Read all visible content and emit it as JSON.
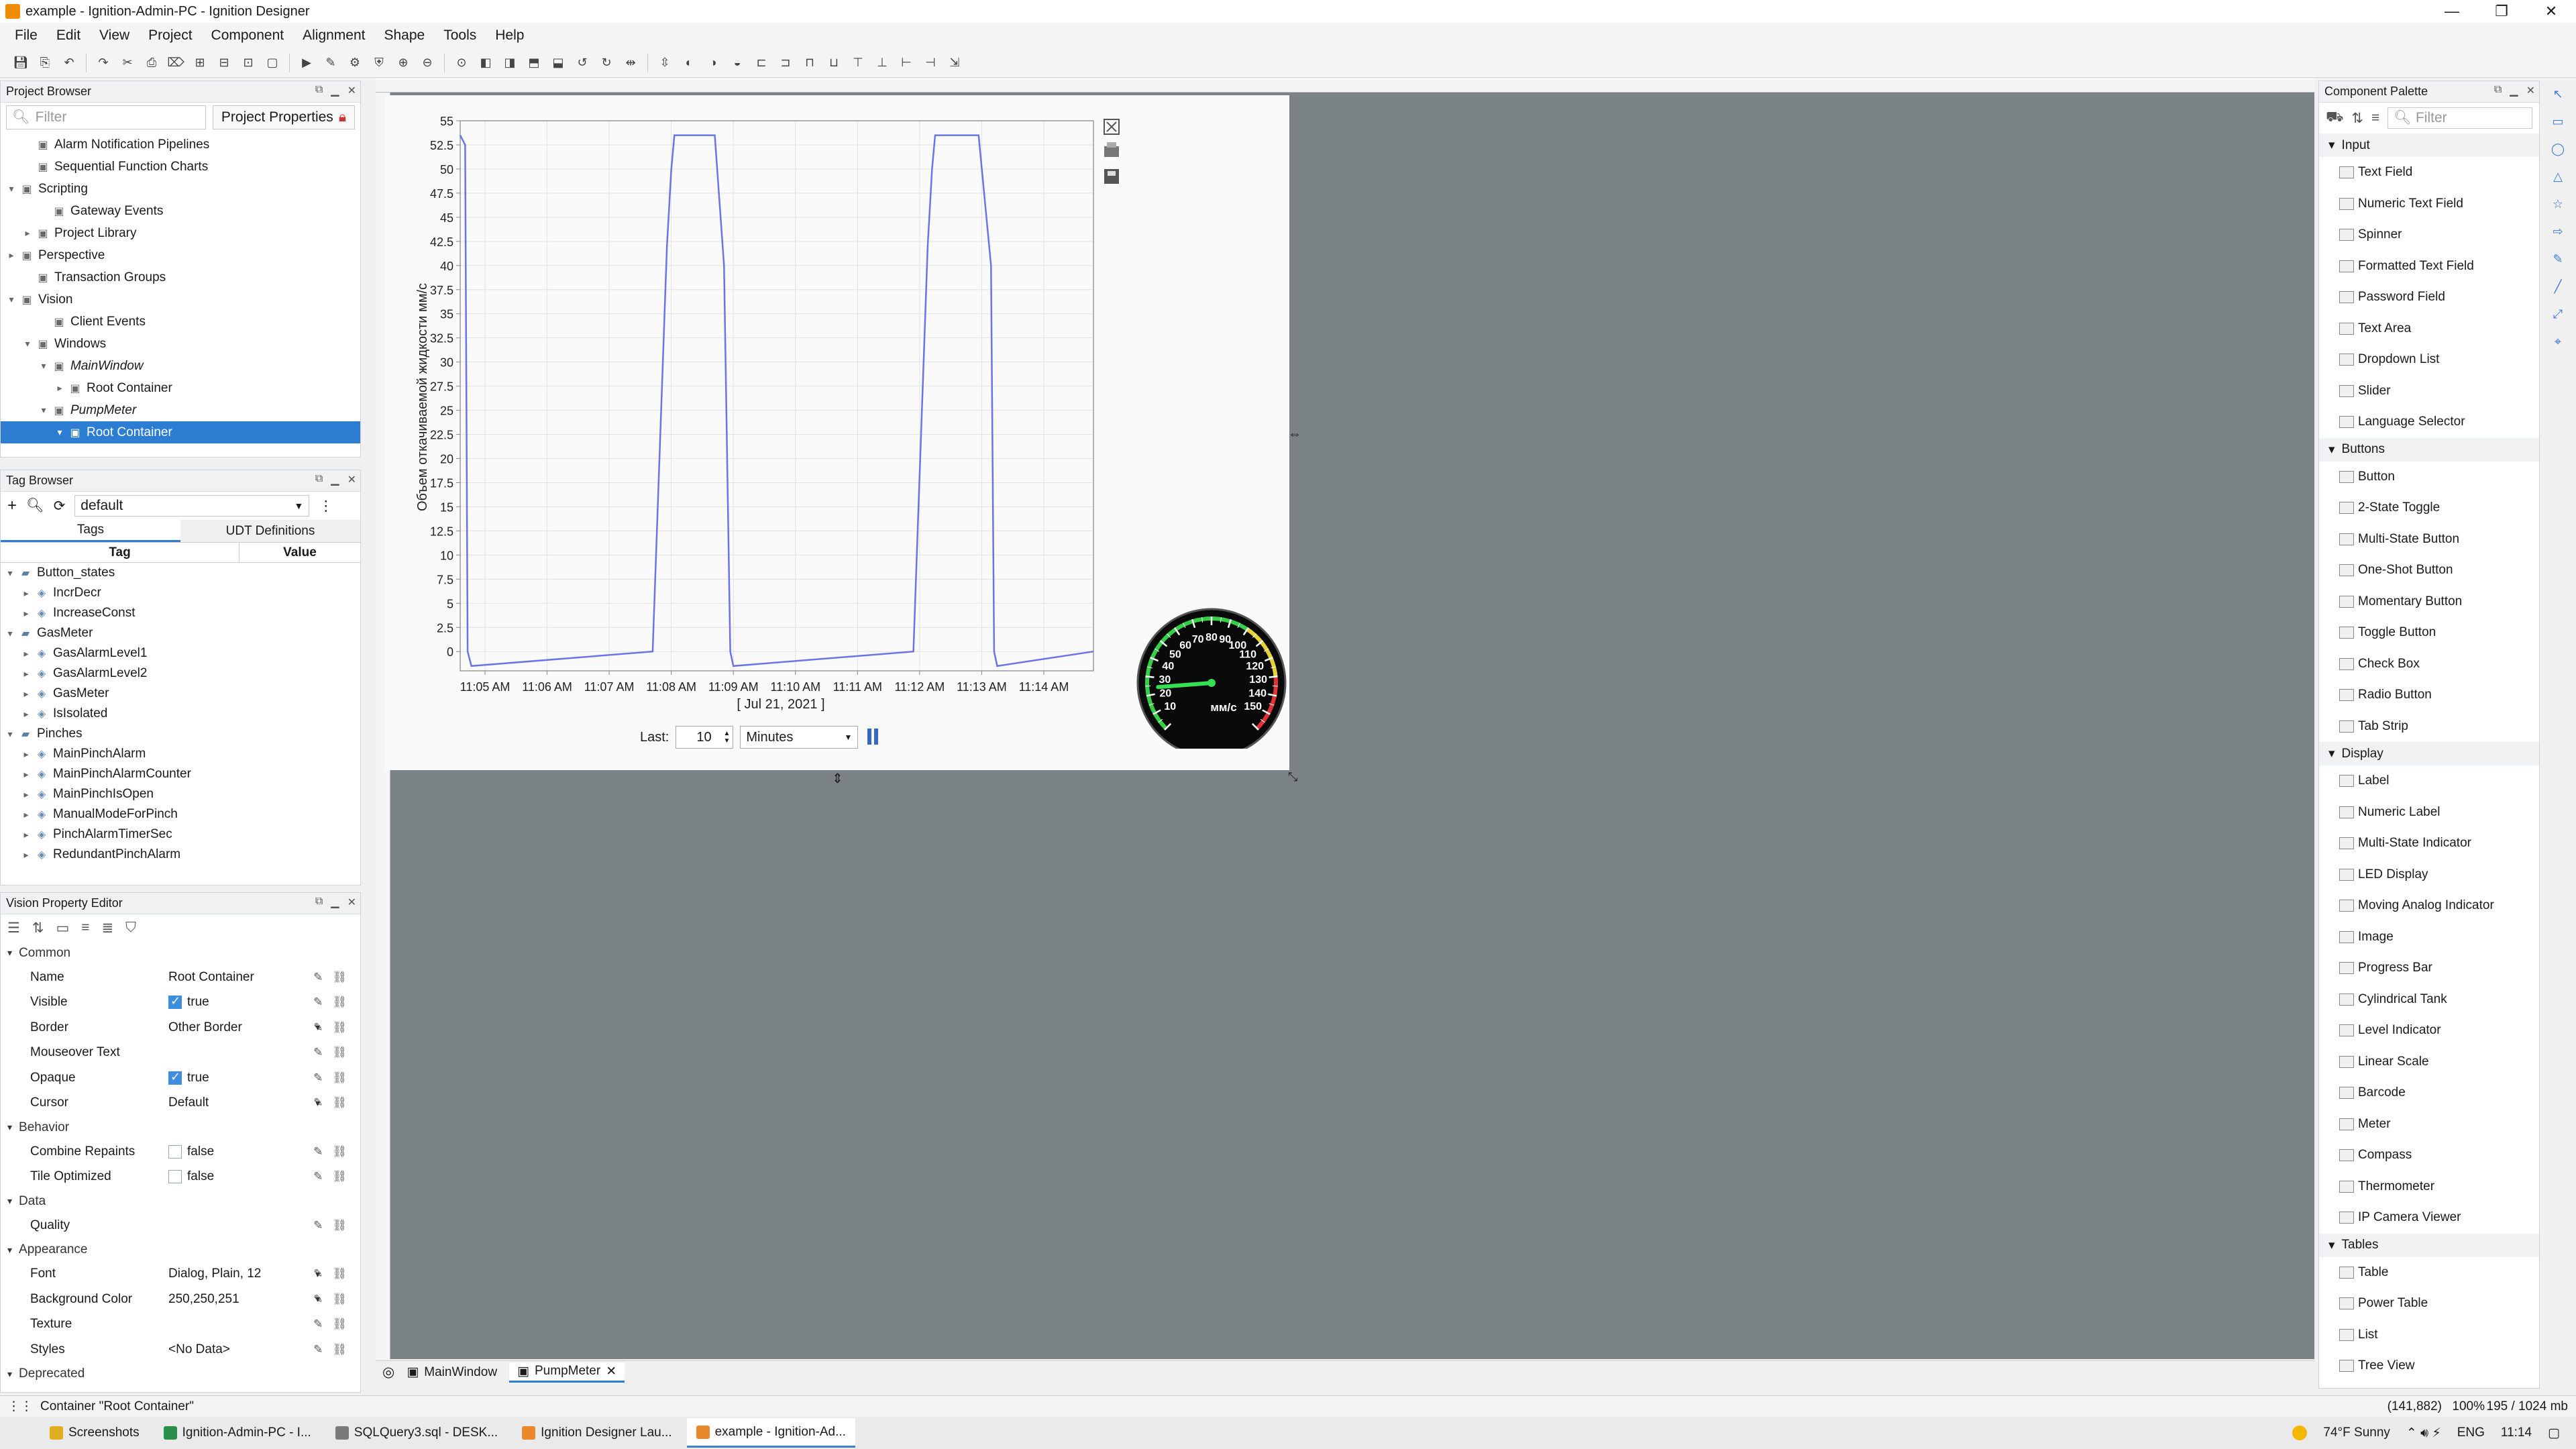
{
  "titlebar": {
    "title": "example - Ignition-Admin-PC - Ignition Designer",
    "minimize": "—",
    "maximize": "❐",
    "close": "✕"
  },
  "menu": [
    "File",
    "Edit",
    "View",
    "Project",
    "Component",
    "Alignment",
    "Shape",
    "Tools",
    "Help"
  ],
  "project_browser": {
    "title": "Project Browser",
    "filter_placeholder": "Filter",
    "properties_button": "Project Properties",
    "items": [
      {
        "label": "Alarm Notification Pipelines",
        "indent": 1,
        "toggle": ""
      },
      {
        "label": "Sequential Function Charts",
        "indent": 1,
        "toggle": ""
      },
      {
        "label": "Scripting",
        "indent": 0,
        "toggle": "▾"
      },
      {
        "label": "Gateway Events",
        "indent": 2,
        "toggle": ""
      },
      {
        "label": "Project Library",
        "indent": 1,
        "toggle": "▸"
      },
      {
        "label": "Perspective",
        "indent": 0,
        "toggle": "▸"
      },
      {
        "label": "Transaction Groups",
        "indent": 1,
        "toggle": ""
      },
      {
        "label": "Vision",
        "indent": 0,
        "toggle": "▾"
      },
      {
        "label": "Client Events",
        "indent": 2,
        "toggle": ""
      },
      {
        "label": "Windows",
        "indent": 1,
        "toggle": "▾"
      },
      {
        "label": "MainWindow",
        "indent": 2,
        "toggle": "▾",
        "italic": true
      },
      {
        "label": "Root Container",
        "indent": 3,
        "toggle": "▸"
      },
      {
        "label": "PumpMeter",
        "indent": 2,
        "toggle": "▾",
        "italic": true
      },
      {
        "label": "Root Container",
        "indent": 3,
        "toggle": "▾",
        "selected": true
      }
    ]
  },
  "tag_browser": {
    "title": "Tag Browser",
    "provider": "default",
    "tabs": [
      "Tags",
      "UDT Definitions"
    ],
    "columns": [
      "Tag",
      "Value"
    ],
    "items": [
      {
        "label": "Button_states",
        "indent": 0,
        "toggle": "▾",
        "folder": true
      },
      {
        "label": "IncrDecr",
        "indent": 1,
        "toggle": "▸"
      },
      {
        "label": "IncreaseConst",
        "indent": 1,
        "toggle": "▸"
      },
      {
        "label": "GasMeter",
        "indent": 0,
        "toggle": "▾",
        "folder": true
      },
      {
        "label": "GasAlarmLevel1",
        "indent": 1,
        "toggle": "▸"
      },
      {
        "label": "GasAlarmLevel2",
        "indent": 1,
        "toggle": "▸"
      },
      {
        "label": "GasMeter",
        "indent": 1,
        "toggle": "▸"
      },
      {
        "label": "IsIsolated",
        "indent": 1,
        "toggle": "▸"
      },
      {
        "label": "Pinches",
        "indent": 0,
        "toggle": "▾",
        "folder": true
      },
      {
        "label": "MainPinchAlarm",
        "indent": 1,
        "toggle": "▸"
      },
      {
        "label": "MainPinchAlarmCounter",
        "indent": 1,
        "toggle": "▸"
      },
      {
        "label": "MainPinchIsOpen",
        "indent": 1,
        "toggle": "▸"
      },
      {
        "label": "ManualModeForPinch",
        "indent": 1,
        "toggle": "▸"
      },
      {
        "label": "PinchAlarmTimerSec",
        "indent": 1,
        "toggle": "▸"
      },
      {
        "label": "RedundantPinchAlarm",
        "indent": 1,
        "toggle": "▸"
      }
    ]
  },
  "property_editor": {
    "title": "Vision Property Editor",
    "groups": [
      {
        "name": "Common",
        "rows": [
          {
            "name": "Name",
            "value": "Root Container"
          },
          {
            "name": "Visible",
            "value": "true",
            "check": true
          },
          {
            "name": "Border",
            "value": "Other Border",
            "dropdown": true
          },
          {
            "name": "Mouseover Text",
            "value": ""
          },
          {
            "name": "Opaque",
            "value": "true",
            "check": true
          },
          {
            "name": "Cursor",
            "value": "Default",
            "dropdown": true
          }
        ]
      },
      {
        "name": "Behavior",
        "rows": [
          {
            "name": "Combine Repaints",
            "value": "false",
            "check": false
          },
          {
            "name": "Tile Optimized",
            "value": "false",
            "check": false
          }
        ]
      },
      {
        "name": "Data",
        "rows": [
          {
            "name": "Quality",
            "value": ""
          }
        ]
      },
      {
        "name": "Appearance",
        "rows": [
          {
            "name": "Font",
            "value": "Dialog, Plain, 12",
            "dropdown": true
          },
          {
            "name": "Background Color",
            "value": "250,250,251",
            "dropdown": true
          },
          {
            "name": "Texture",
            "value": ""
          },
          {
            "name": "Styles",
            "value": "<No Data>"
          }
        ]
      },
      {
        "name": "Deprecated",
        "rows": []
      }
    ]
  },
  "easy_chart": {
    "y_axis_label": "Объем откачиваемой жидкости мм/с",
    "date_label": "[ Jul 21, 2021 ]",
    "last_label": "Last:",
    "last_value": "10",
    "unit": "Minutes"
  },
  "chart_data": {
    "type": "line",
    "title": "",
    "xlabel": "[ Jul 21, 2021 ]",
    "ylabel": "Объем откачиваемой жидкости мм/с",
    "ylim": [
      -2,
      55
    ],
    "y_ticks": [
      "0",
      "2.5",
      "5",
      "7.5",
      "10",
      "12.5",
      "15",
      "17.5",
      "20",
      "22.5",
      "25",
      "27.5",
      "30",
      "32.5",
      "35",
      "37.5",
      "40",
      "42.5",
      "45",
      "47.5",
      "50",
      "52.5",
      "55"
    ],
    "x_ticks": [
      "11:05 AM",
      "11:06 AM",
      "11:07 AM",
      "11:08 AM",
      "11:09 AM",
      "11:10 AM",
      "11:11 AM",
      "11:12 AM",
      "11:13 AM",
      "11:14 AM"
    ],
    "xlim": [
      -0.4,
      9.8
    ],
    "x": [
      -0.4,
      -0.32,
      -0.28,
      -0.22,
      2.7,
      2.93,
      3.0,
      3.05,
      3.7,
      3.85,
      3.95,
      4.0,
      6.9,
      7.13,
      7.2,
      7.25,
      7.95,
      8.15,
      8.2,
      8.25,
      9.8
    ],
    "y": [
      53.5,
      52.5,
      0,
      -1.5,
      0,
      42,
      50,
      53.5,
      53.5,
      40,
      0,
      -1.5,
      0,
      42,
      50,
      53.5,
      53.5,
      40,
      0,
      -1.5,
      0
    ],
    "grid": true,
    "line_color": "#6b73e8"
  },
  "meter": {
    "unit": "мм/с",
    "labels": [
      "10",
      "20",
      "30",
      "40",
      "50",
      "60",
      "70",
      "80",
      "90",
      "100",
      "110",
      "120",
      "130",
      "140",
      "150"
    ],
    "min": 0,
    "max": 160,
    "value": 24
  },
  "designer_tabs": [
    "MainWindow",
    "PumpMeter"
  ],
  "palette": {
    "title": "Component Palette",
    "filter_placeholder": "Filter",
    "groups": [
      {
        "name": "Input",
        "items": [
          "Text Field",
          "Numeric Text Field",
          "Spinner",
          "Formatted Text Field",
          "Password Field",
          "Text Area",
          "Dropdown List",
          "Slider",
          "Language Selector"
        ]
      },
      {
        "name": "Buttons",
        "items": [
          "Button",
          "2-State Toggle",
          "Multi-State Button",
          "One-Shot Button",
          "Momentary Button",
          "Toggle Button",
          "Check Box",
          "Radio Button",
          "Tab Strip"
        ]
      },
      {
        "name": "Display",
        "items": [
          "Label",
          "Numeric Label",
          "Multi-State Indicator",
          "LED Display",
          "Moving Analog Indicator",
          "Image",
          "Progress Bar",
          "Cylindrical Tank",
          "Level Indicator",
          "Linear Scale",
          "Barcode",
          "Meter",
          "Compass",
          "Thermometer",
          "IP Camera Viewer"
        ]
      },
      {
        "name": "Tables",
        "items": [
          "Table",
          "Power Table",
          "List",
          "Tree View"
        ]
      }
    ]
  },
  "status": {
    "left": "Container \"Root Container\"",
    "coords": "(141,882)",
    "zoom": "100%",
    "memory": "195 / 1024 mb"
  },
  "taskbar": {
    "items": [
      "Screenshots",
      "Ignition-Admin-PC - I...",
      "SQLQuery3.sql - DESK...",
      "Ignition Designer Lau...",
      "example - Ignition-Ad..."
    ],
    "weather": "74°F  Sunny",
    "lang": "ENG",
    "time": "11:14"
  }
}
